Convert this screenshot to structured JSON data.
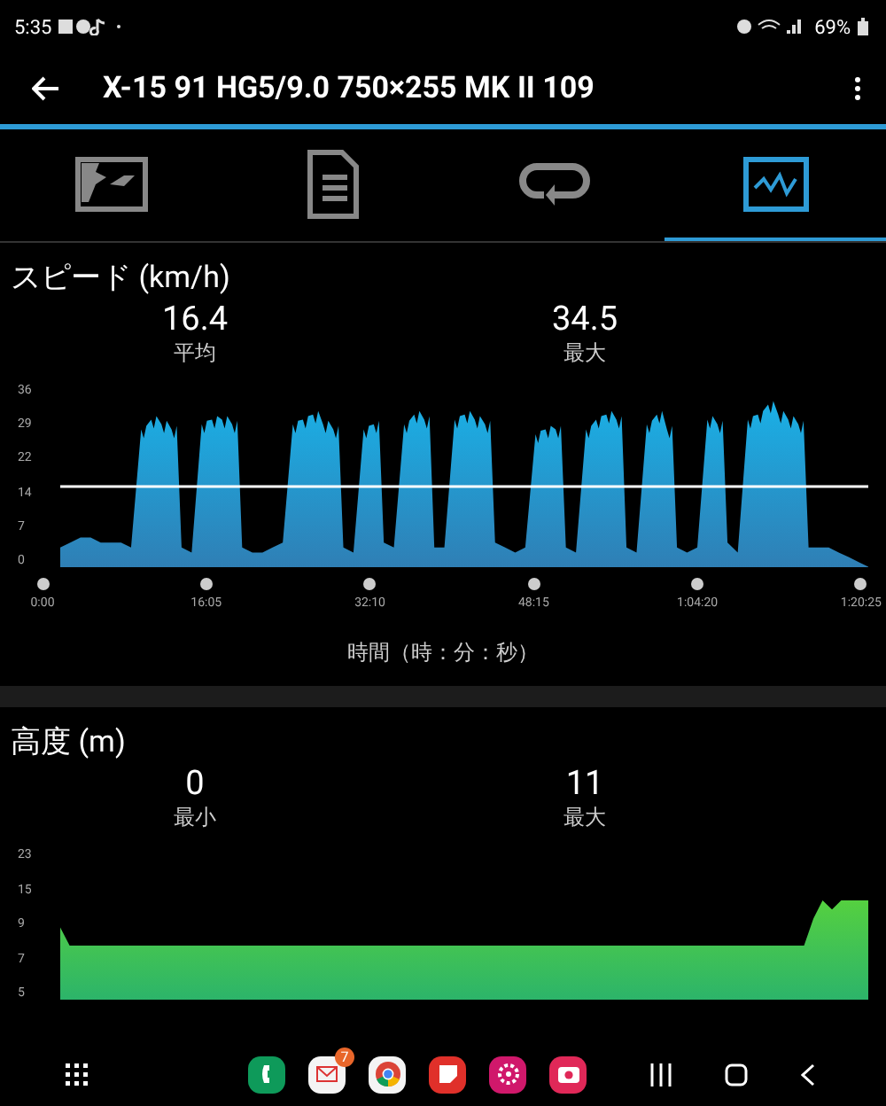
{
  "status_bar": {
    "time": "5:35",
    "battery": "69%"
  },
  "app_bar": {
    "title": "X-15 91 HG5/9.0 750×255 MK II 109"
  },
  "tabs": [
    {
      "kind": "map",
      "selected": false
    },
    {
      "kind": "details",
      "selected": false
    },
    {
      "kind": "laps",
      "selected": false
    },
    {
      "kind": "graph",
      "selected": true
    }
  ],
  "speed": {
    "heading": "スピード (km/h)",
    "stats": [
      {
        "value": "16.4",
        "label": "平均"
      },
      {
        "value": "34.5",
        "label": "最大"
      }
    ],
    "y_ticks": [
      "36",
      "29",
      "22",
      "14",
      "7",
      "0"
    ],
    "x_ticks": [
      "0:00",
      "16:05",
      "32:10",
      "48:15",
      "1:04:20",
      "1:20:25"
    ],
    "x_label": "時間（時：分：秒）"
  },
  "altitude": {
    "heading": "高度 (m)",
    "stats": [
      {
        "value": "0",
        "label": "最小"
      },
      {
        "value": "11",
        "label": "最大"
      }
    ],
    "y_ticks": [
      "23",
      "15",
      "9",
      "7",
      "5"
    ]
  },
  "dock": {
    "mail_badge": "7"
  }
}
